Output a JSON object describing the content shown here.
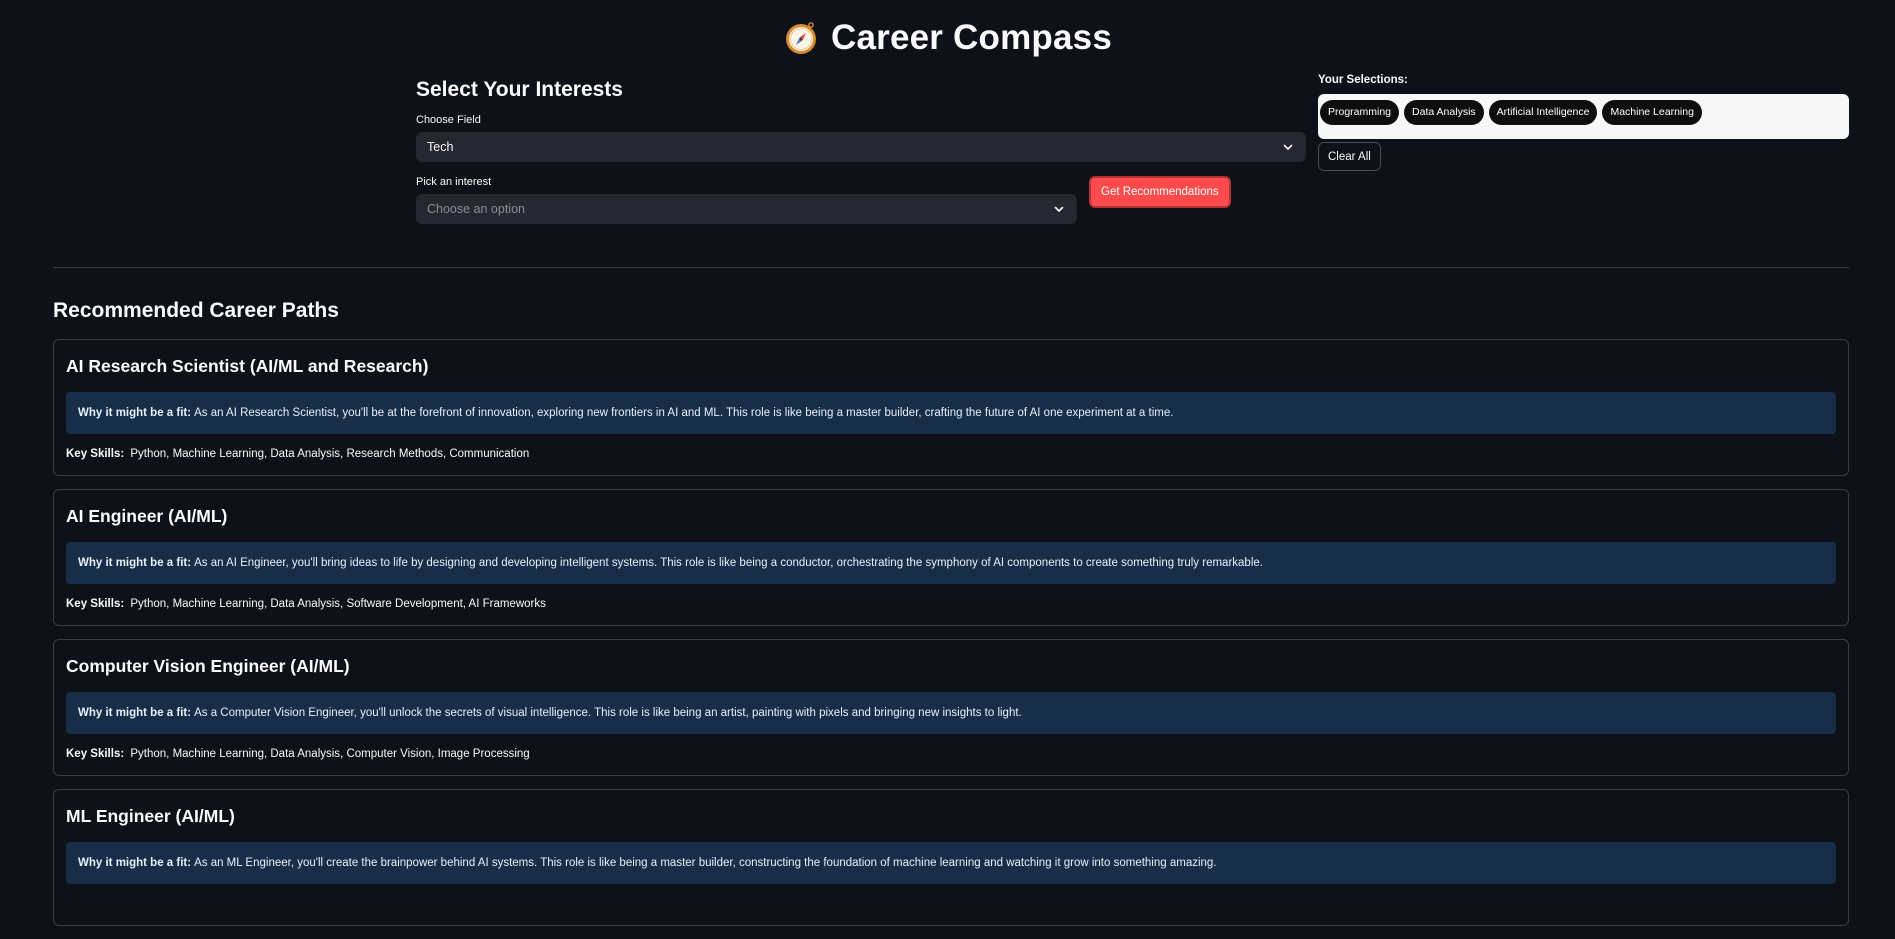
{
  "app": {
    "title": "Career Compass"
  },
  "selector": {
    "heading": "Select Your Interests",
    "field_label": "Choose Field",
    "field_value": "Tech",
    "interest_label": "Pick an interest",
    "interest_placeholder": "Choose an option",
    "recommend_button": "Get Recommendations"
  },
  "selections": {
    "title": "Your Selections:",
    "chips": [
      "Programming",
      "Data Analysis",
      "Artificial Intelligence",
      "Machine Learning"
    ],
    "clear_button": "Clear All"
  },
  "recommendations": {
    "heading": "Recommended Career Paths",
    "fit_label": "Why it might be a fit:",
    "skills_label": "Key Skills:",
    "cards": [
      {
        "title": "AI Research Scientist (AI/ML and Research)",
        "fit": "As an AI Research Scientist, you'll be at the forefront of innovation, exploring new frontiers in AI and ML. This role is like being a master builder, crafting the future of AI one experiment at a time.",
        "skills": "Python, Machine Learning, Data Analysis, Research Methods, Communication"
      },
      {
        "title": "AI Engineer (AI/ML)",
        "fit": "As an AI Engineer, you'll bring ideas to life by designing and developing intelligent systems. This role is like being a conductor, orchestrating the symphony of AI components to create something truly remarkable.",
        "skills": "Python, Machine Learning, Data Analysis, Software Development, AI Frameworks"
      },
      {
        "title": "Computer Vision Engineer (AI/ML)",
        "fit": "As a Computer Vision Engineer, you'll unlock the secrets of visual intelligence. This role is like being an artist, painting with pixels and bringing new insights to light.",
        "skills": "Python, Machine Learning, Data Analysis, Computer Vision, Image Processing"
      },
      {
        "title": "ML Engineer (AI/ML)",
        "fit": "As an ML Engineer, you'll create the brainpower behind AI systems. This role is like being a master builder, constructing the foundation of machine learning and watching it grow into something amazing.",
        "skills": ""
      }
    ]
  },
  "icons": {
    "title_icon": "compass-icon",
    "dropdown_icon": "chevron-down-icon"
  }
}
